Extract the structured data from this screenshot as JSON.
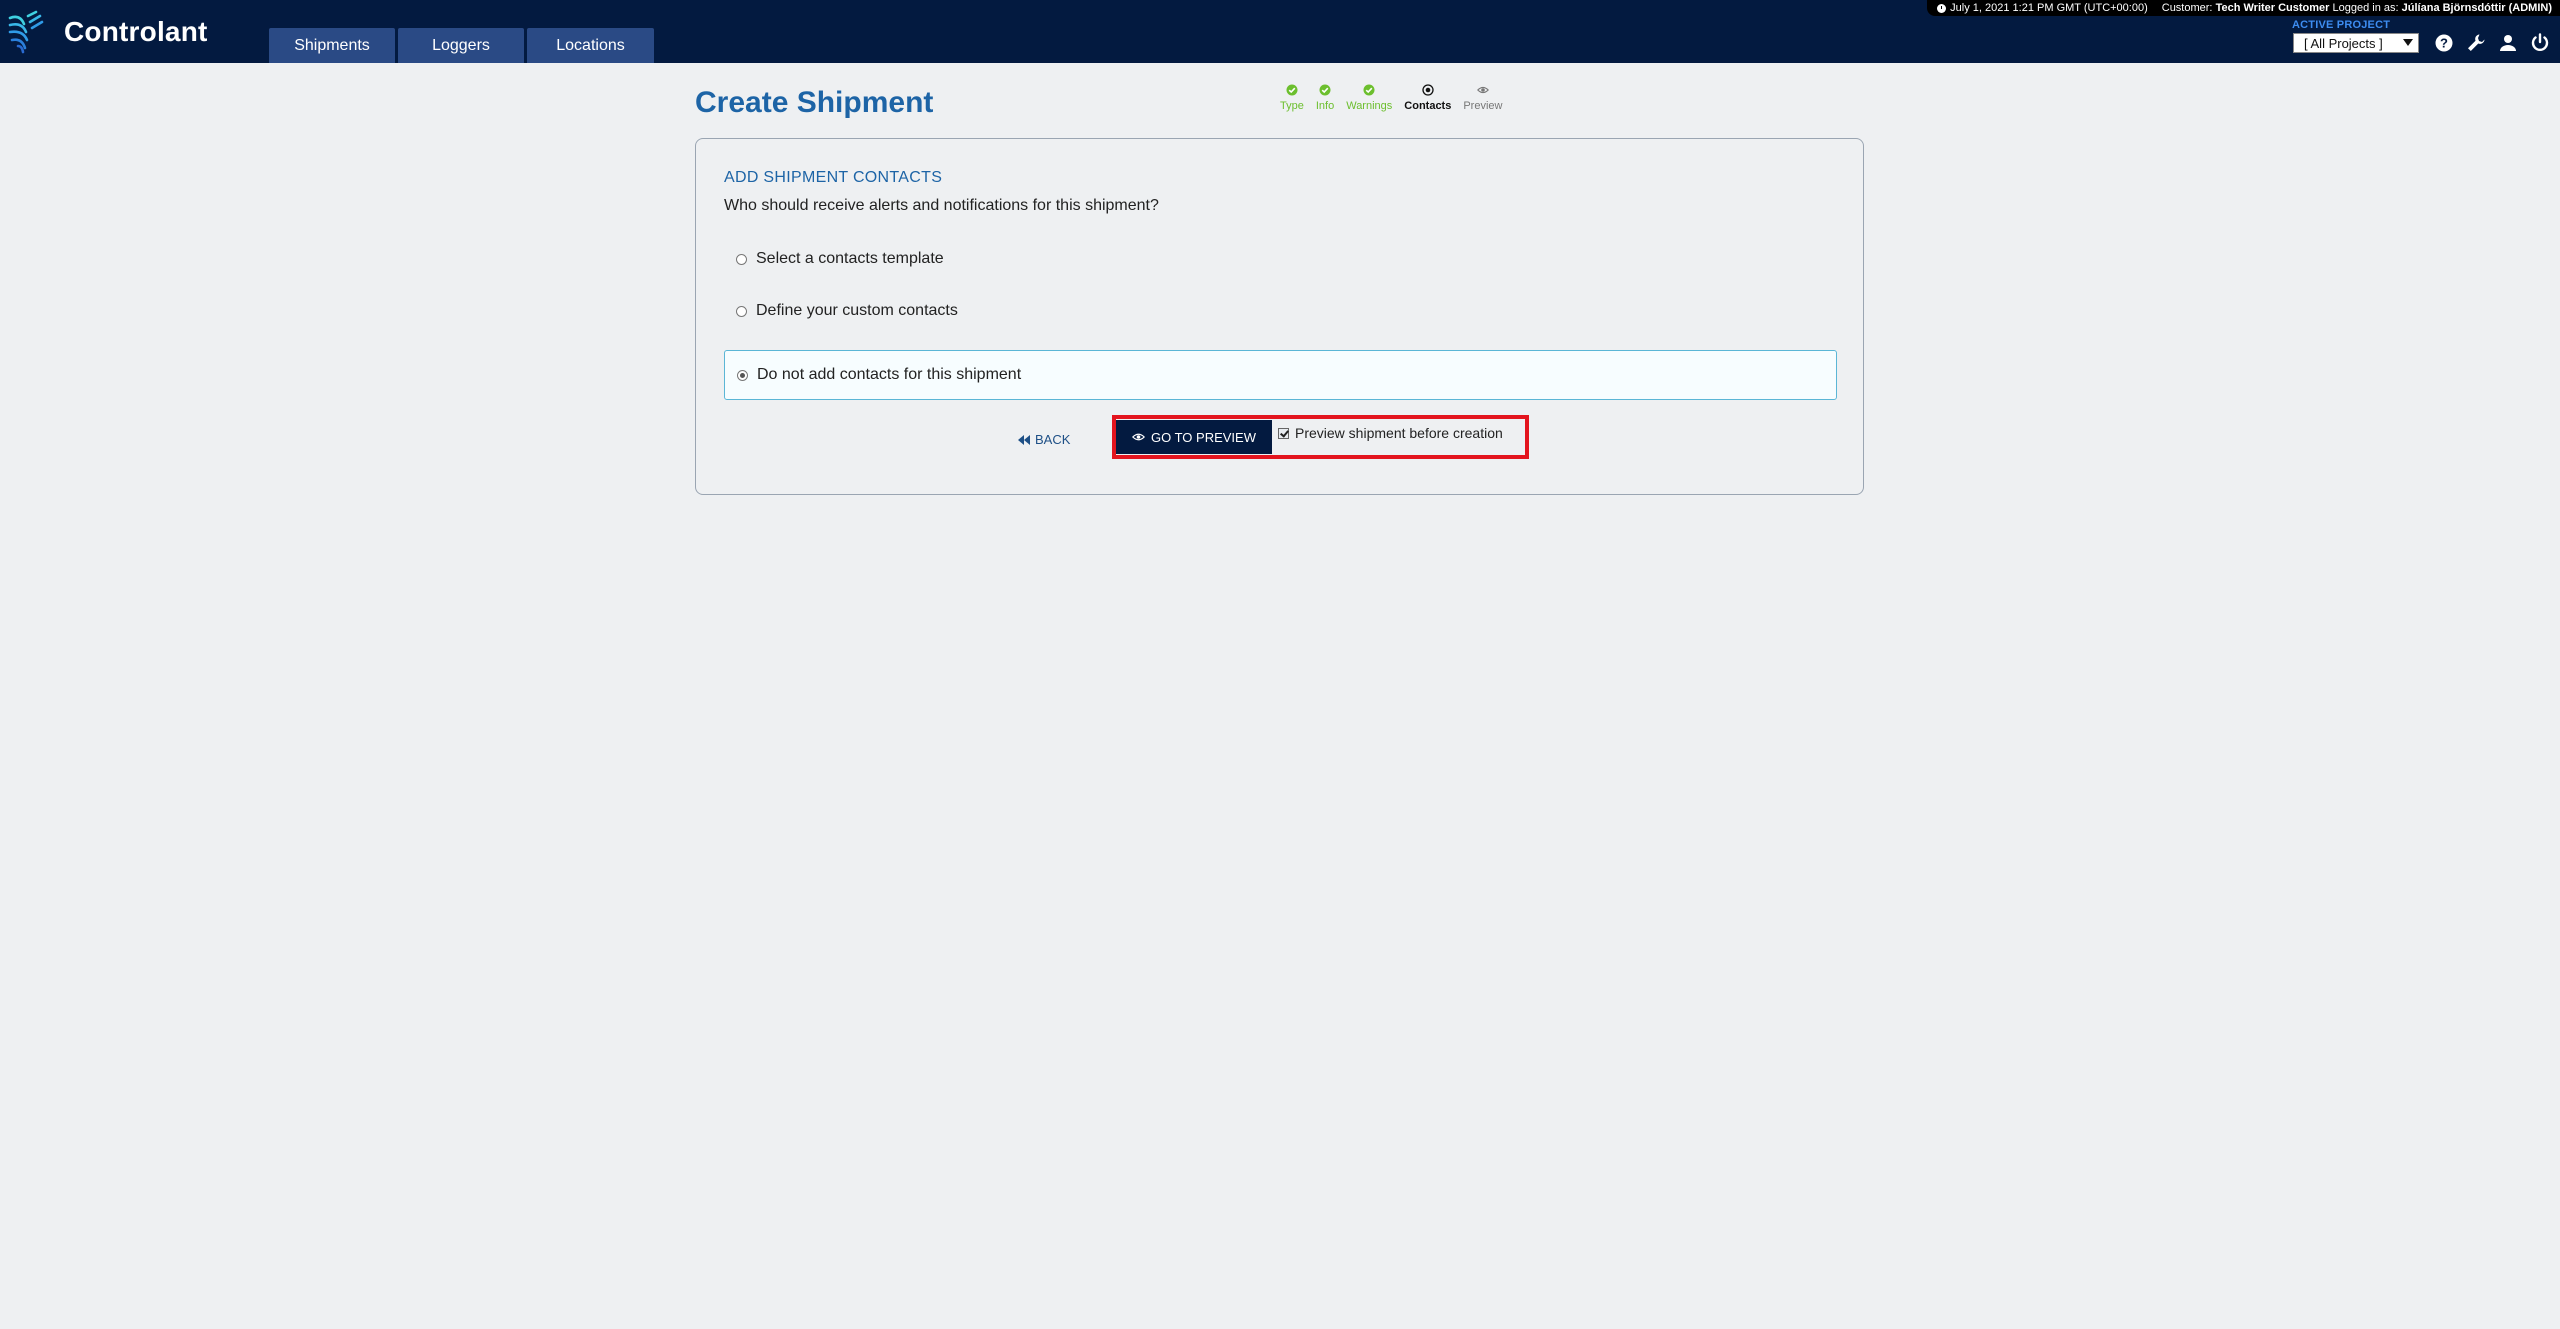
{
  "app": {
    "brand": "Controlant",
    "nav_tabs": [
      {
        "label": "Shipments"
      },
      {
        "label": "Loggers"
      },
      {
        "label": "Locations"
      }
    ],
    "status": {
      "datetime": "July 1, 2021 1:21 PM GMT (UTC+00:00)",
      "customer_prefix": "Customer:",
      "customer": "Tech Writer Customer",
      "logged_prefix": "Logged in as:",
      "user": "Júlíana Björnsdóttir (ADMIN)"
    },
    "project": {
      "label": "ACTIVE PROJECT",
      "selected": "[ All Projects ]"
    },
    "icons": [
      "help-icon",
      "wrench-icon",
      "user-icon",
      "power-icon"
    ]
  },
  "page": {
    "title": "Create Shipment",
    "steps": [
      {
        "label": "Type",
        "state": "done"
      },
      {
        "label": "Info",
        "state": "done"
      },
      {
        "label": "Warnings",
        "state": "done"
      },
      {
        "label": "Contacts",
        "state": "active"
      },
      {
        "label": "Preview",
        "state": "future"
      }
    ]
  },
  "form": {
    "section_title": "ADD SHIPMENT CONTACTS",
    "section_subtitle": "Who should receive alerts and notifications for this shipment?",
    "options": [
      {
        "label": "Select a contacts template",
        "selected": false
      },
      {
        "label": "Define your custom contacts",
        "selected": false
      },
      {
        "label": "Do not add contacts for this shipment",
        "selected": true
      }
    ],
    "back_label": "BACK",
    "go_label": "GO TO PREVIEW",
    "preview_checkbox_label": "Preview shipment before creation",
    "preview_checked": true
  },
  "colors": {
    "topbar": "#031a40",
    "nav_tab": "#2a4a85",
    "title_blue": "#1d64a6",
    "step_done": "#6cbf2e",
    "highlight_red": "#e3141e",
    "selected_border": "#5bb6d6"
  }
}
